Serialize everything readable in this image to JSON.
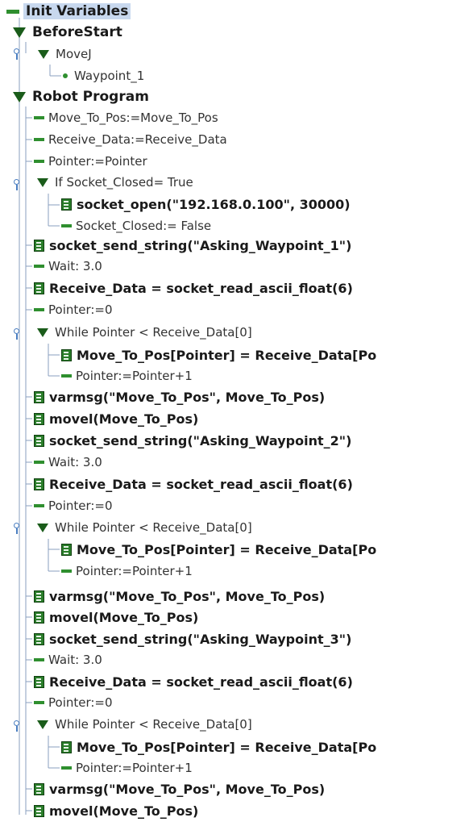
{
  "program_tree": {
    "init_variables": "Init Variables",
    "before_start": "BeforeStart",
    "movej": "MoveJ",
    "waypoint_1": "Waypoint_1",
    "robot_program": "Robot Program",
    "nodes": [
      "Move_To_Pos:=Move_To_Pos",
      "Receive_Data:=Receive_Data",
      "Pointer:=Pointer",
      "If Socket_Closed= True",
      "socket_open(\"192.168.0.100\", 30000)",
      "Socket_Closed:= False",
      "socket_send_string(\"Asking_Waypoint_1\")",
      "Wait: 3.0",
      "Receive_Data = socket_read_ascii_float(6)",
      "Pointer:=0",
      "While Pointer < Receive_Data[0]",
      "Move_To_Pos[Pointer] = Receive_Data[Po",
      "Pointer:=Pointer+1",
      "varmsg(\"Move_To_Pos\", Move_To_Pos)",
      "movel(Move_To_Pos)",
      "socket_send_string(\"Asking_Waypoint_2\")",
      "Wait: 3.0",
      "Receive_Data = socket_read_ascii_float(6)",
      "Pointer:=0",
      "While Pointer < Receive_Data[0]",
      "Move_To_Pos[Pointer] = Receive_Data[Po",
      "Pointer:=Pointer+1",
      "varmsg(\"Move_To_Pos\", Move_To_Pos)",
      "movel(Move_To_Pos)",
      "socket_send_string(\"Asking_Waypoint_3\")",
      "Wait: 3.0",
      "Receive_Data = socket_read_ascii_float(6)",
      "Pointer:=0",
      "While Pointer < Receive_Data[0]",
      "Move_To_Pos[Pointer] = Receive_Data[Po",
      "Pointer:=Pointer+1",
      "varmsg(\"Move_To_Pos\", Move_To_Pos)",
      "movel(Move_To_Pos)"
    ]
  },
  "icons": {
    "assignment": "assignment-icon",
    "folder": "folder-triangle-icon",
    "script": "script-icon",
    "waypoint": "waypoint-dot-icon",
    "node_pin": "node-pin-icon"
  },
  "colors": {
    "icon_green": "#2f8f2f",
    "tree_line": "#8a9fbf",
    "selection": "#c8d8ee"
  }
}
